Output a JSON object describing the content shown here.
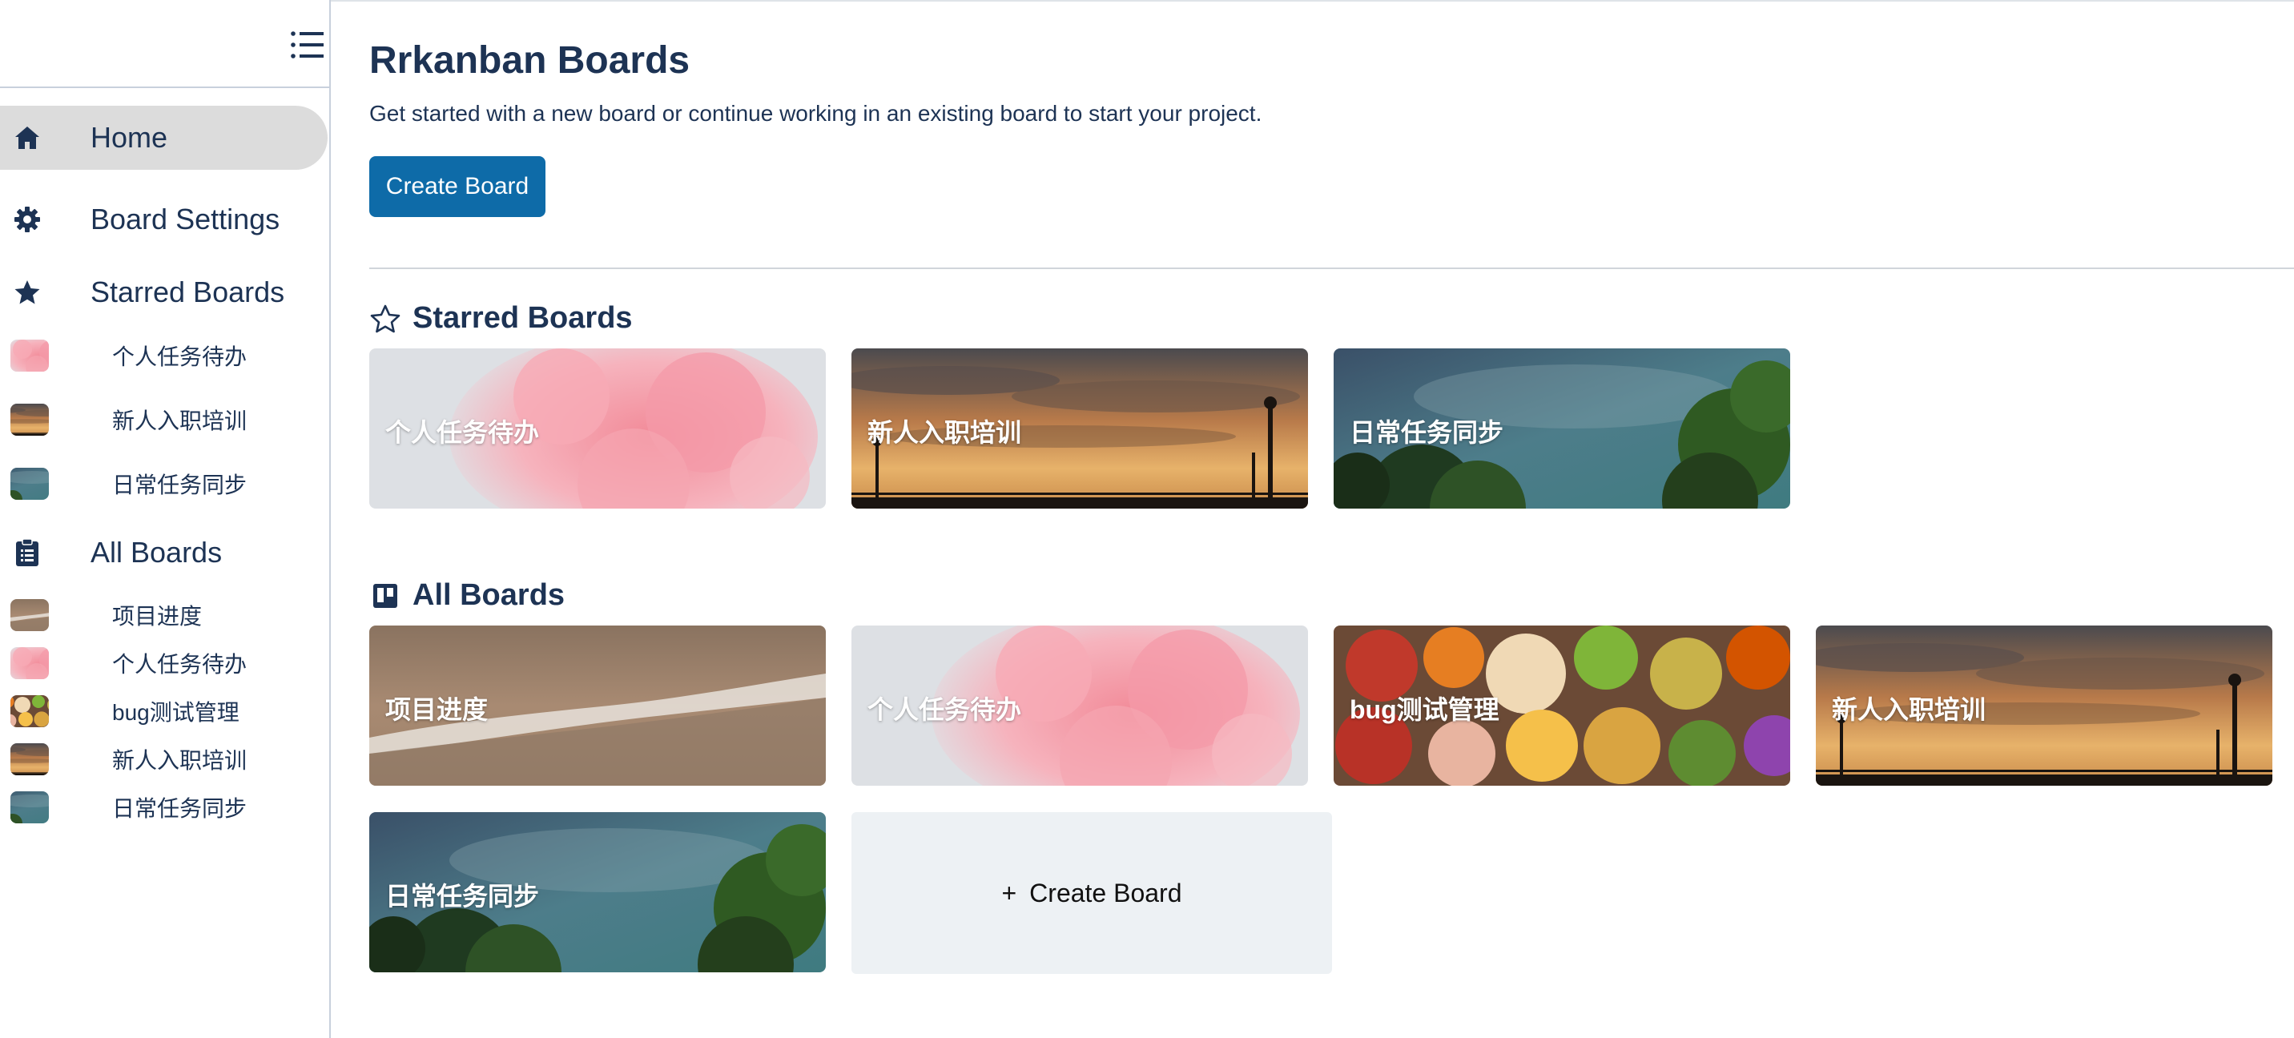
{
  "app": {
    "title": "Rrkanban Boards",
    "subtitle": "Get started with a new board or continue working in an existing board to start your project.",
    "create_label": "Create Board"
  },
  "sidebar": {
    "menu_icon": "list-icon",
    "home": {
      "label": "Home",
      "icon": "home-icon"
    },
    "settings": {
      "label": "Board Settings",
      "icon": "gear-icon"
    },
    "starred": {
      "label": "Starred Boards",
      "icon": "star-icon",
      "items": [
        {
          "label": "个人任务待办",
          "theme": "pink-smoke"
        },
        {
          "label": "新人入职培训",
          "theme": "sunset"
        },
        {
          "label": "日常任务同步",
          "theme": "night-sky"
        }
      ]
    },
    "all": {
      "label": "All Boards",
      "icon": "clipboard-icon",
      "items": [
        {
          "label": "项目进度",
          "theme": "sand"
        },
        {
          "label": "个人任务待办",
          "theme": "pink-smoke"
        },
        {
          "label": "bug测试管理",
          "theme": "food"
        },
        {
          "label": "新人入职培训",
          "theme": "sunset"
        },
        {
          "label": "日常任务同步",
          "theme": "night-sky"
        }
      ]
    }
  },
  "sections": {
    "starred": {
      "title": "Starred Boards",
      "icon": "star-outline-icon",
      "boards": [
        {
          "name": "个人任务待办",
          "theme": "pink-smoke"
        },
        {
          "name": "新人入职培训",
          "theme": "sunset"
        },
        {
          "name": "日常任务同步",
          "theme": "night-sky"
        }
      ]
    },
    "all": {
      "title": "All Boards",
      "icon": "board-icon",
      "boards": [
        {
          "name": "项目进度",
          "theme": "sand"
        },
        {
          "name": "个人任务待办",
          "theme": "pink-smoke"
        },
        {
          "name": "bug测试管理",
          "theme": "food"
        },
        {
          "name": "新人入职培训",
          "theme": "sunset"
        },
        {
          "name": "日常任务同步",
          "theme": "night-sky"
        }
      ],
      "create_card": {
        "plus": "+",
        "label": "Create Board"
      }
    }
  },
  "colors": {
    "text": "#1d3354",
    "accent": "#0e6ba8",
    "active_nav": "#dcdcdc",
    "create_card_bg": "#edf1f4"
  }
}
